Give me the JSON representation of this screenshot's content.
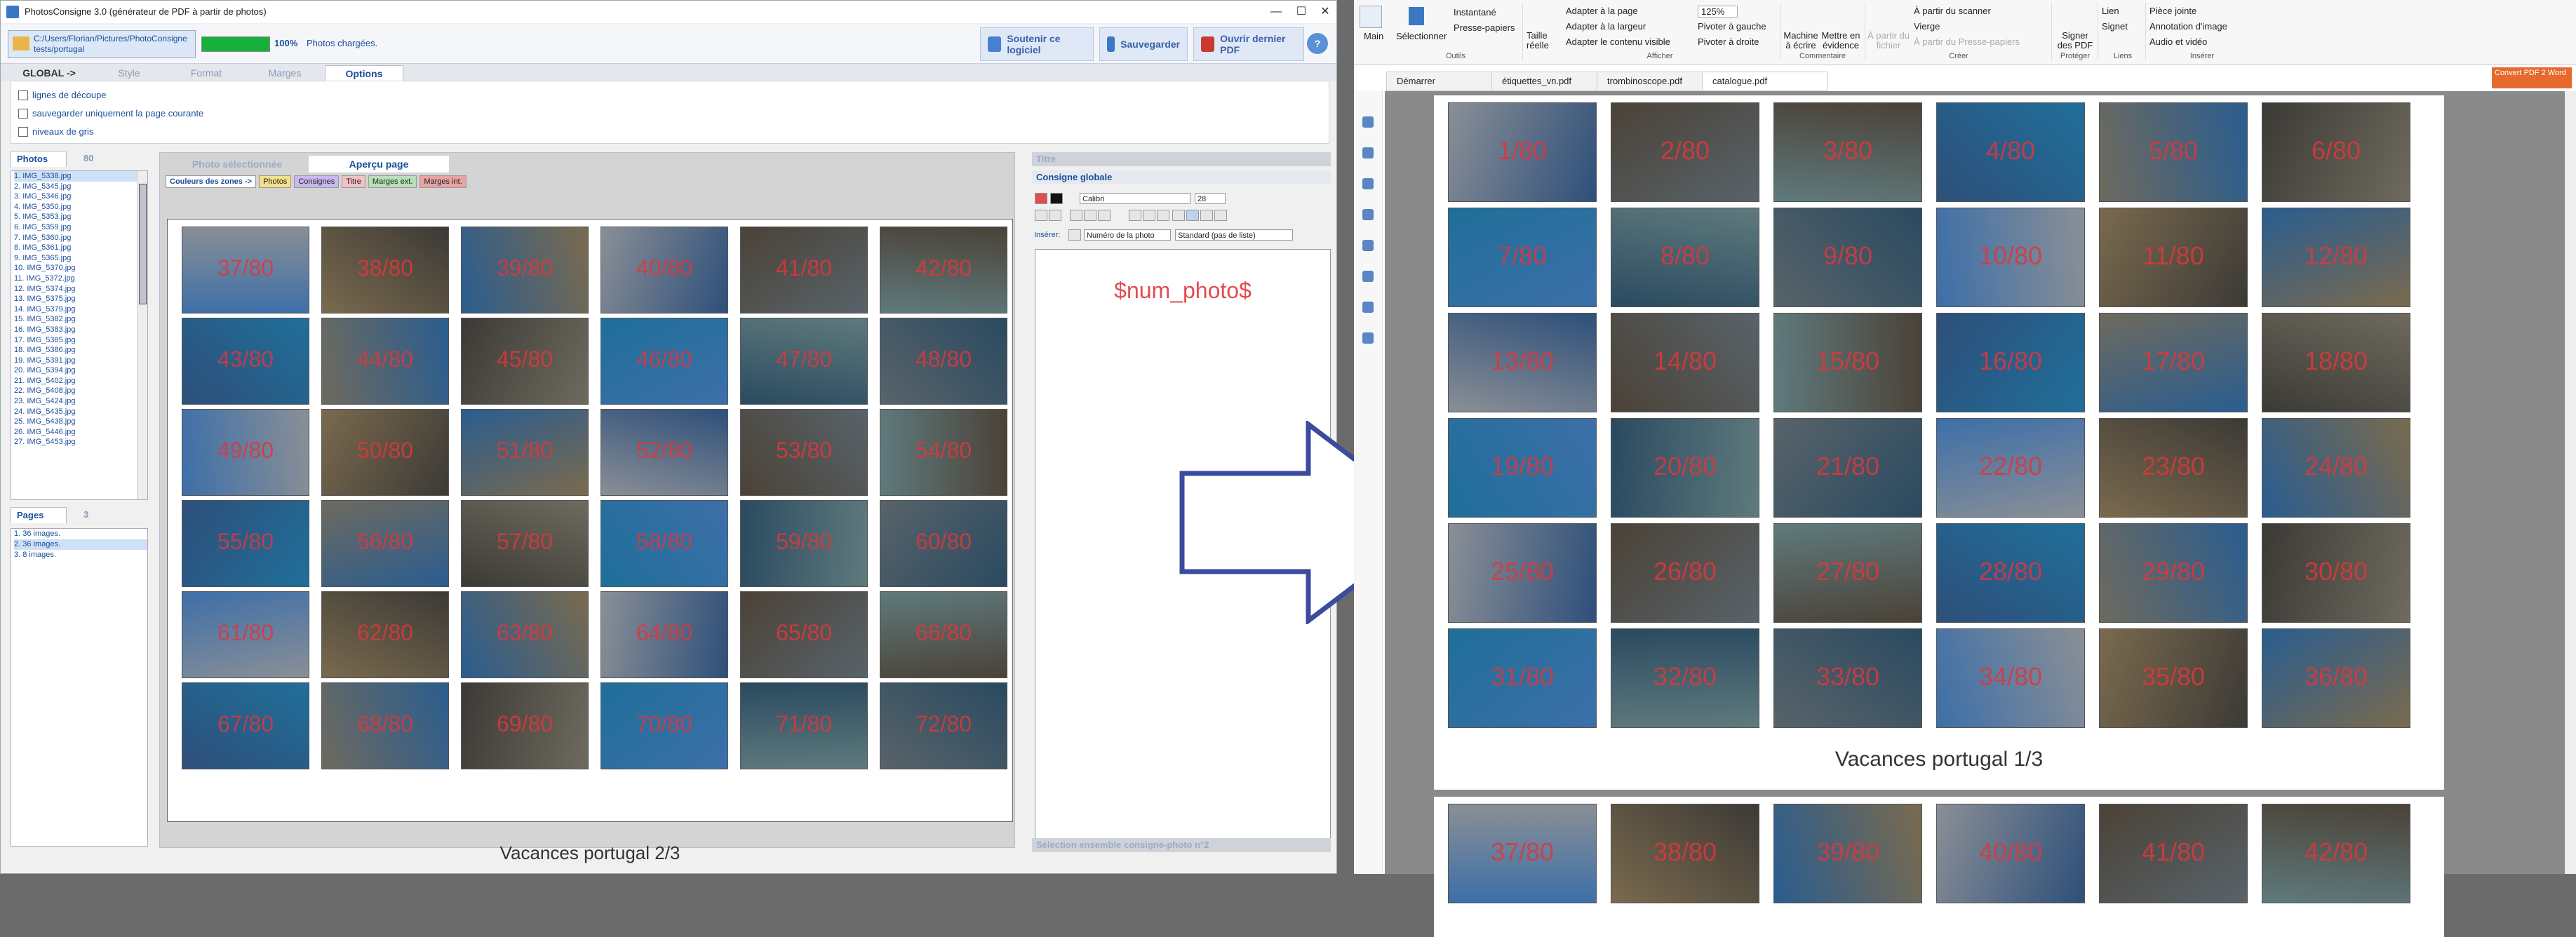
{
  "app": {
    "title": "PhotosConsigne 3.0 (générateur de PDF à partir de photos)",
    "window_buttons": [
      "—",
      "☐",
      "✕"
    ]
  },
  "toolbar": {
    "path": "C:/Users/Florian/Pictures/PhotoConsigne tests/portugal",
    "progress": 1.0,
    "progress_text": "100%",
    "status": "Photos chargées.",
    "support_label": "Soutenir ce logiciel",
    "save_label": "Sauvegarder",
    "open_label": "Ouvrir dernier PDF",
    "help_label": "?"
  },
  "main_tabs": [
    "GLOBAL ->",
    "Style",
    "Format",
    "Marges",
    "Options"
  ],
  "options": {
    "cut_lines": "lignes de découpe",
    "save_current_page": "sauvegarder uniquement la page courante",
    "grayscale": "niveaux de gris"
  },
  "left_panel": {
    "tab_photos": "Photos",
    "tab_photos_count": "80",
    "files": [
      "1. IMG_5338.jpg",
      "2. IMG_5345.jpg",
      "3. IMG_5346.jpg",
      "4. IMG_5350.jpg",
      "5. IMG_5353.jpg",
      "6. IMG_5359.jpg",
      "7. IMG_5360.jpg",
      "8. IMG_5361.jpg",
      "9. IMG_5365.jpg",
      "10. IMG_5370.jpg",
      "11. IMG_5372.jpg",
      "12. IMG_5374.jpg",
      "13. IMG_5375.jpg",
      "14. IMG_5379.jpg",
      "15. IMG_5382.jpg",
      "16. IMG_5383.jpg",
      "17. IMG_5385.jpg",
      "18. IMG_5386.jpg",
      "19. IMG_5391.jpg",
      "20. IMG_5394.jpg",
      "21. IMG_5402.jpg",
      "22. IMG_5408.jpg",
      "23. IMG_5424.jpg",
      "24. IMG_5435.jpg",
      "25. IMG_5438.jpg",
      "26. IMG_5446.jpg",
      "27. IMG_5453.jpg"
    ],
    "tab_pages": "Pages",
    "tab_pages_count": "3",
    "pages": [
      "1. 36 images.",
      "2. 36 images.",
      "3. 8 images."
    ]
  },
  "center_panel": {
    "tab_selected": "Photo sélectionnée",
    "tab_preview": "Aperçu page",
    "zone_label": "Couleurs des zones ->",
    "zones": [
      "Photos",
      "Consignes",
      "Titre",
      "Marges ext.",
      "Marges int."
    ],
    "zone_colors": [
      "#f3e08a",
      "#c9b8f0",
      "#f2c1c6",
      "#b7e0b7",
      "#e7a3a3"
    ],
    "photo_numbers": [
      "37/80",
      "38/80",
      "39/80",
      "40/80",
      "41/80",
      "42/80",
      "43/80",
      "44/80",
      "45/80",
      "46/80",
      "47/80",
      "48/80",
      "49/80",
      "50/80",
      "51/80",
      "52/80",
      "53/80",
      "54/80",
      "55/80",
      "56/80",
      "57/80",
      "58/80",
      "59/80",
      "60/80",
      "61/80",
      "62/80",
      "63/80",
      "64/80",
      "65/80",
      "66/80",
      "67/80",
      "68/80",
      "69/80",
      "70/80",
      "71/80",
      "72/80"
    ],
    "page_caption": "Vacances portugal 2/3"
  },
  "right_panel": {
    "section_title": "Titre",
    "section_global": "Consigne globale",
    "font": "Calibri",
    "size": "28",
    "insert_label": "Insérer:",
    "insert_value": "Numéro de la photo",
    "list_value": "Standard (pas de liste)",
    "editor_text": "$num_photo$",
    "footer": "Sélection ensemble consigne-photo n°2"
  },
  "pdf": {
    "ribbon": {
      "main": "Main",
      "select": "Sélectionner",
      "snapshot": "Instantané",
      "clipboard": "Presse-papiers",
      "actual_size": "Taille réelle",
      "fit_page": "Adapter à la page",
      "fit_width": "Adapter à la largeur",
      "fit_visible": "Adapter le contenu visible",
      "zoom": "125%",
      "rotate_left": "Pivoter à gauche",
      "rotate_right": "Pivoter à droite",
      "typewriter": "Machine à écrire",
      "highlight": "Mettre en évidence",
      "from_file": "À partir du fichier",
      "from_scanner": "À partir du scanner",
      "blank": "Vierge",
      "from_clipboard": "À partir du Presse-papiers",
      "sign": "Signer des PDF",
      "link": "Lien",
      "bookmark": "Signet",
      "attachment": "Pièce jointe",
      "image_annotation": "Annotation d'image",
      "audio_video": "Audio et vidéo",
      "group_tools": "Outils",
      "group_display": "Afficher",
      "group_comment": "Commentaire",
      "group_create": "Créer",
      "group_protect": "Protéger",
      "group_links": "Liens",
      "group_insert": "Insérer"
    },
    "doc_tabs": [
      "Démarrer",
      "étiquettes_vn.pdf",
      "trombinoscope.pdf",
      "catalogue.pdf"
    ],
    "convert": "Convert PDF 2 Word",
    "page1_numbers": [
      "1/80",
      "2/80",
      "3/80",
      "4/80",
      "5/80",
      "6/80",
      "7/80",
      "8/80",
      "9/80",
      "10/80",
      "11/80",
      "12/80",
      "13/80",
      "14/80",
      "15/80",
      "16/80",
      "17/80",
      "18/80",
      "19/80",
      "20/80",
      "21/80",
      "22/80",
      "23/80",
      "24/80",
      "25/80",
      "26/80",
      "27/80",
      "28/80",
      "29/80",
      "30/80",
      "31/80",
      "32/80",
      "33/80",
      "34/80",
      "35/80",
      "36/80"
    ],
    "page1_caption": "Vacances portugal 1/3",
    "page2_numbers": [
      "37/80",
      "38/80",
      "39/80",
      "40/80",
      "41/80",
      "42/80"
    ]
  }
}
